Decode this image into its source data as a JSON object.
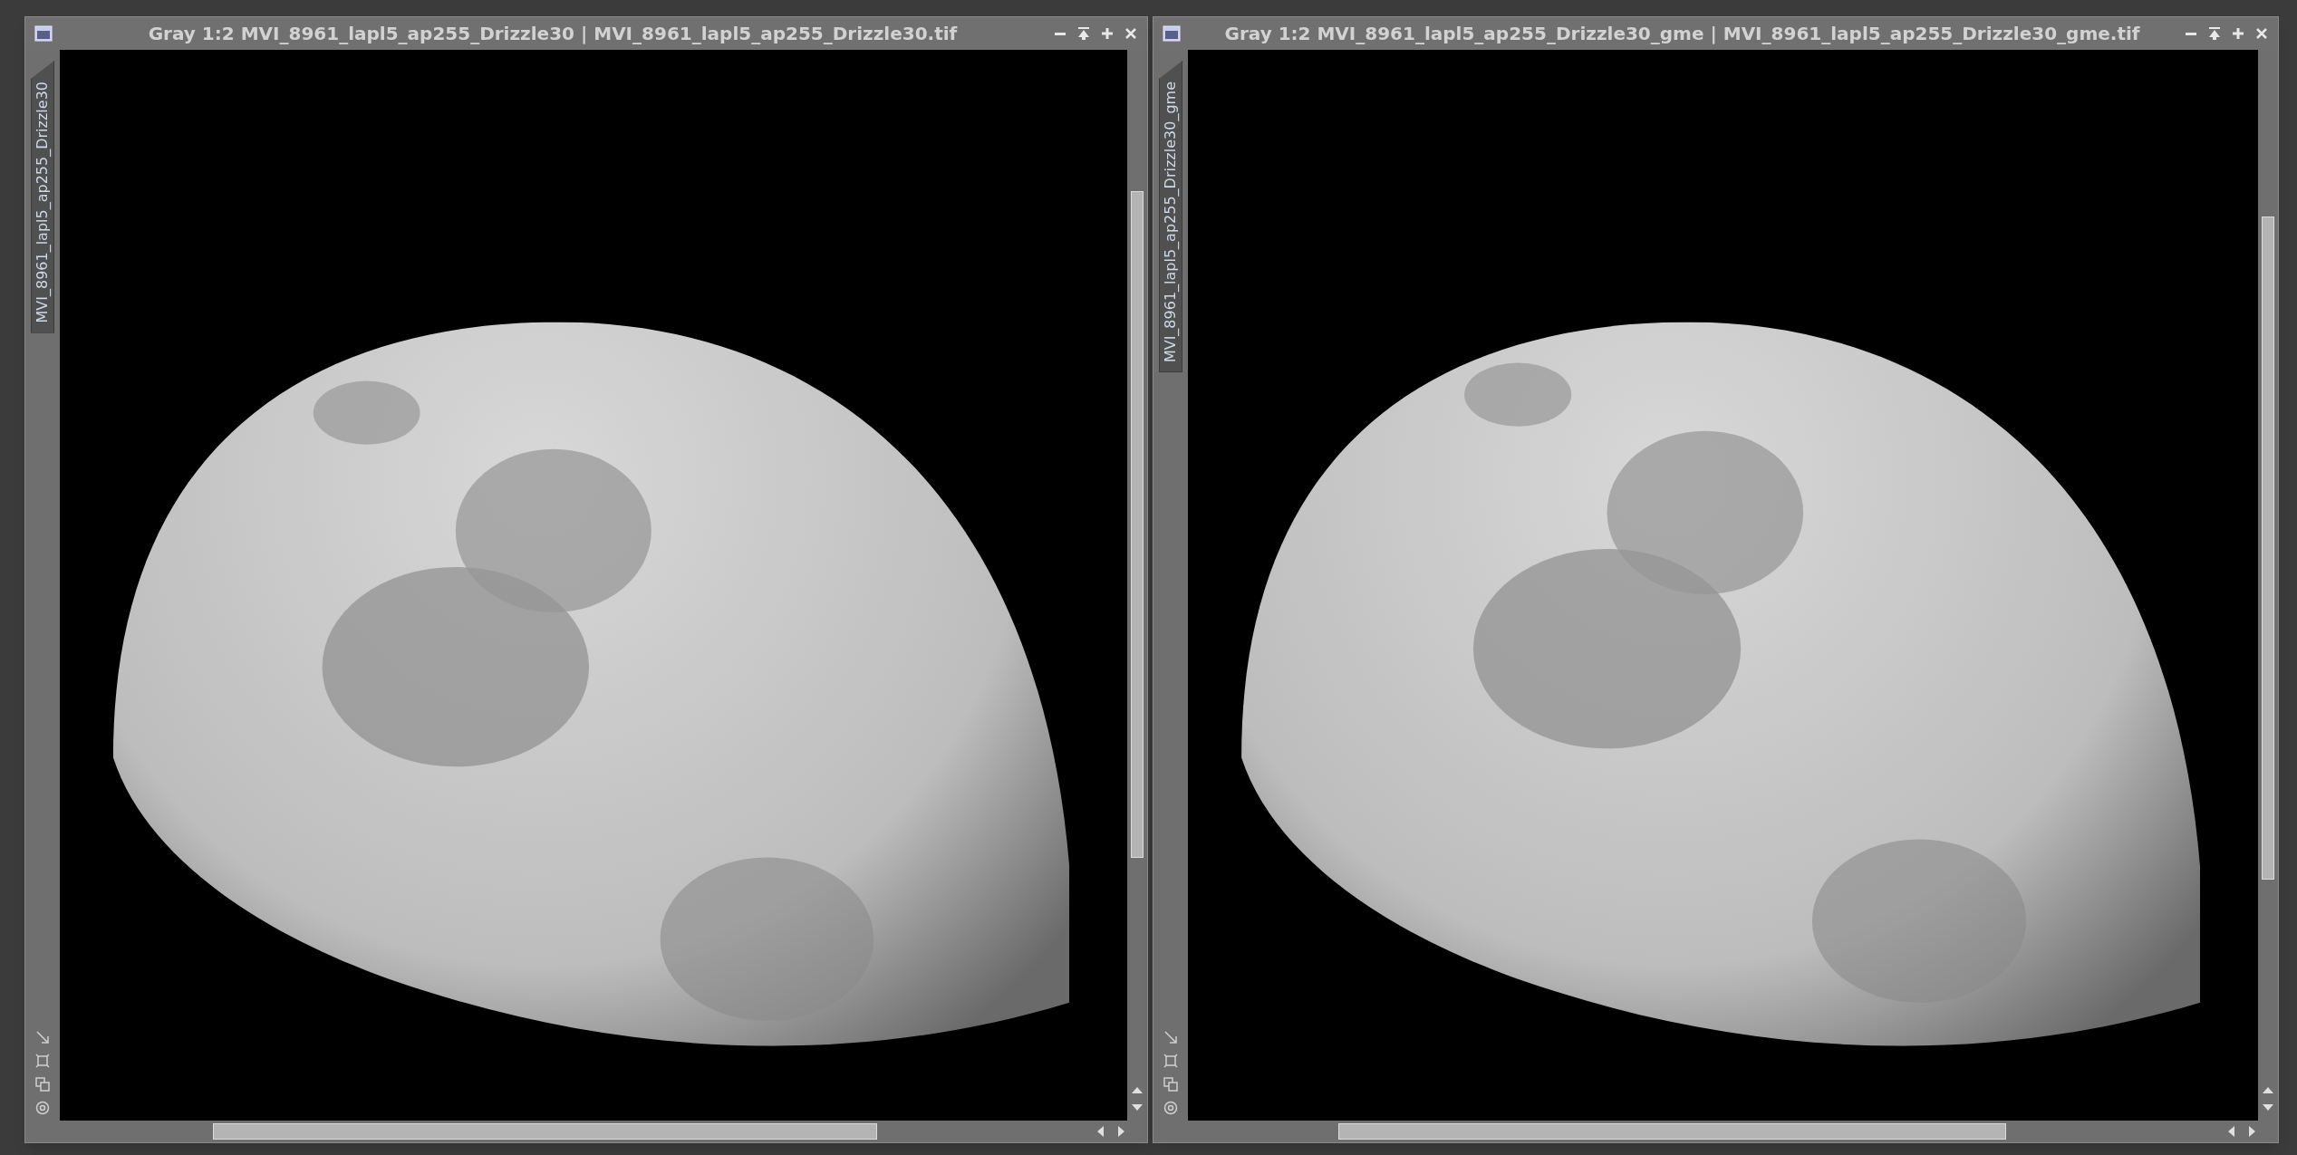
{
  "windows": [
    {
      "title": "Gray 1:2 MVI_8961_lapl5_ap255_Drizzle30 | MVI_8961_lapl5_ap255_Drizzle30.tif",
      "side_tab": "MVI_8961_lapl5_ap255_Drizzle30"
    },
    {
      "title": "Gray 1:2 MVI_8961_lapl5_ap255_Drizzle30_gme | MVI_8961_lapl5_ap255_Drizzle30_gme.tif",
      "side_tab": "MVI_8961_lapl5_ap255_Drizzle30_gme"
    }
  ]
}
